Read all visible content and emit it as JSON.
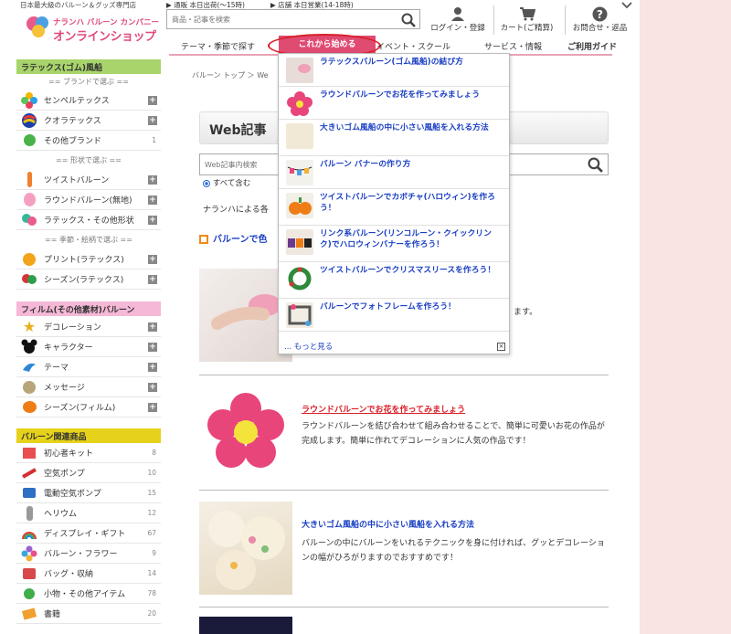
{
  "header": {
    "tagline": "日本最大級のバルーン＆グッズ専門店",
    "brand_top": "ナランハ バルーン カンパニー",
    "brand_main": "オンラインショップ",
    "shipping_today": "▶ 通販 本日出荷(～15時)",
    "store_today": "▶ 店舗 本日営業(14-18時)",
    "search_placeholder": "商品・記事を検索",
    "login_label": "ログイン・登録",
    "cart_label": "カート(ご精算)",
    "contact_label": "お問合せ・返品"
  },
  "nav": {
    "tabs": [
      "テーマ・季節で探す",
      "これから始める",
      "イベント・スクール",
      "サービス・情報",
      "ご利用ガイド"
    ]
  },
  "sidebar": {
    "latex_head": "ラテックス(ゴム)風船",
    "brand_sub": "== ブランドで選ぶ ==",
    "brand_items": [
      "センペルテックス",
      "クオラテックス",
      "その他ブランド"
    ],
    "shape_sub": "== 形状で選ぶ ==",
    "shape_items": [
      "ツイストバルーン",
      "ラウンドバルーン(無地)",
      "ラテックス・その他形状"
    ],
    "season_sub": "== 季節・絵柄で選ぶ ==",
    "season_items": [
      "プリント(ラテックス)",
      "シーズン(ラテックス)"
    ],
    "film_head": "フィルム(その他素材)バルーン",
    "film_items": [
      "デコレーション",
      "キャラクター",
      "テーマ",
      "メッセージ",
      "シーズン(フィルム)"
    ],
    "related_head": "バルーン関連商品",
    "related_items": [
      {
        "label": "初心者キット",
        "count": "8"
      },
      {
        "label": "空気ポンプ",
        "count": "10"
      },
      {
        "label": "電動空気ポンプ",
        "count": "15"
      },
      {
        "label": "ヘリウム",
        "count": "12"
      },
      {
        "label": "ディスプレイ・ギフト",
        "count": "67"
      },
      {
        "label": "バルーン・フラワー",
        "count": "9"
      },
      {
        "label": "バッグ・収納",
        "count": "14"
      },
      {
        "label": "小物・その他アイテム",
        "count": "78"
      },
      {
        "label": "書籍",
        "count": "20"
      }
    ],
    "brand_other_count": "1"
  },
  "main": {
    "breadcrumb": "バルーン トップ ＞ We",
    "title": "Web記事",
    "search_placeholder": "Web記事内検索",
    "radio_all": "すべて含む",
    "intro": "ナランハによる各",
    "section_title": "バルーンで色",
    "articles": [
      {
        "title": "",
        "desc": "ます。"
      },
      {
        "title": "ラウンドバルーンでお花を作ってみましょう",
        "desc": "ラウンドバルーンを結び合わせて組み合わせることで、簡単に可愛いお花の作品が完成します。簡単に作れてデコレーションに人気の作品です！"
      },
      {
        "title": "大きいゴム風船の中に小さい風船を入れる方法",
        "desc": "バルーンの中にバルーンをいれるテクニックを身に付ければ、グッとデコレーションの幅がひろがりますのでおすすめです！"
      }
    ]
  },
  "dropdown": {
    "items": [
      "ラテックスバルーン(ゴム風船)の結び方",
      "ラウンドバルーンでお花を作ってみましょう",
      "大きいゴム風船の中に小さい風船を入れる方法",
      "バルーン バナーの作り方",
      "ツイストバルーンでカボチャ(ハロウィン)を作ろう！",
      "リンク系バルーン(リンコルーン・クイックリンク)でハロウィンバナーを作ろう！",
      "ツイストバルーンでクリスマスリースを作ろう！",
      "バルーンでフォトフレームを作ろう！"
    ],
    "more": "... もっと見る",
    "close": "×"
  },
  "colors": {
    "latex_head_bg": "#a8d46b",
    "film_head_bg": "#f5b8d6",
    "related_head_bg": "#e6d21a",
    "accent_pink": "#e04b72",
    "link_blue": "#1a3fc4"
  }
}
